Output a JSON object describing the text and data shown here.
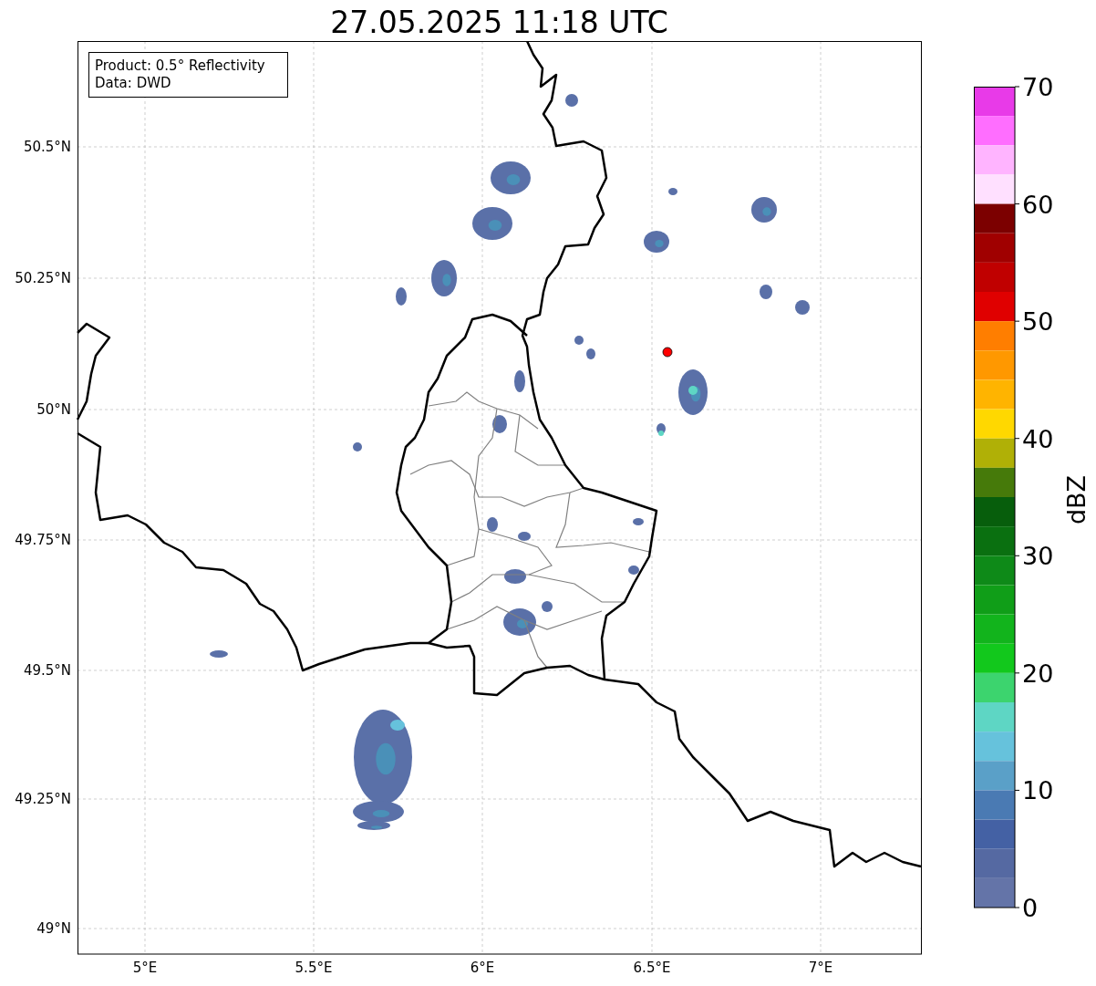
{
  "title": "27.05.2025 11:18 UTC",
  "info_box": [
    "Product: 0.5° Reflectivity",
    "Data: DWD"
  ],
  "map": {
    "x_tick_labels": [
      "5°E",
      "5.5°E",
      "6°E",
      "6.5°E",
      "7°E"
    ],
    "y_tick_labels": [
      "50.5°N",
      "50.25°N",
      "50°N",
      "49.75°N",
      "49.5°N",
      "49.25°N",
      "49°N"
    ]
  },
  "colorbar": {
    "label": "dBZ",
    "ticks": [
      "70",
      "60",
      "50",
      "40",
      "30",
      "20",
      "10",
      "0"
    ],
    "segments": [
      {
        "color": "#e83ae8"
      },
      {
        "color": "#ff6eff"
      },
      {
        "color": "#ffb4ff"
      },
      {
        "color": "#ffe0ff"
      },
      {
        "color": "#7c0000"
      },
      {
        "color": "#a00000"
      },
      {
        "color": "#c00000"
      },
      {
        "color": "#e00000"
      },
      {
        "color": "#ff7e00"
      },
      {
        "color": "#ff9800"
      },
      {
        "color": "#ffb400"
      },
      {
        "color": "#ffd800"
      },
      {
        "color": "#b0b006"
      },
      {
        "color": "#467a0a"
      },
      {
        "color": "#075e0c"
      },
      {
        "color": "#0a7010"
      },
      {
        "color": "#0e8a18"
      },
      {
        "color": "#109e18"
      },
      {
        "color": "#12b41c"
      },
      {
        "color": "#12c81c"
      },
      {
        "color": "#3cd46e"
      },
      {
        "color": "#5ed6c4"
      },
      {
        "color": "#66c2dc"
      },
      {
        "color": "#5aa0c8"
      },
      {
        "color": "#4a7ab3"
      },
      {
        "color": "#4461a4"
      },
      {
        "color": "#5569a2"
      },
      {
        "color": "#6474a8"
      }
    ]
  }
}
